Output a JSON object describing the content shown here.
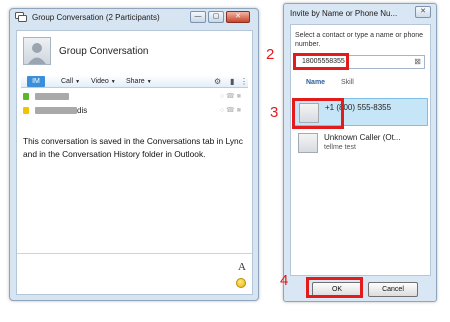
{
  "left_window": {
    "title": "Group Conversation (2 Participants)",
    "header_title": "Group Conversation",
    "toolbar": {
      "im_label": "IM",
      "call_label": "Call",
      "video_label": "Video",
      "share_label": "Share"
    },
    "participants": [
      {
        "name_suffix": "",
        "presence_color": "#5cb82a"
      },
      {
        "name_suffix": "dis",
        "presence_color": "#f2c400"
      }
    ],
    "message": "This conversation is saved in the Conversations tab in Lync and in the Conversation History folder in Outlook.",
    "compose": {
      "font_button": "A"
    }
  },
  "right_window": {
    "title": "Invite by Name or Phone Nu...",
    "instruction": "Select a contact or type a name or phone number.",
    "search_value": "18005558355",
    "columns": {
      "name": "Name",
      "skill": "Skill"
    },
    "results": [
      {
        "name": "+1 (800) 555-8355",
        "sub": "",
        "selected": true
      },
      {
        "name": "Unknown Caller (Ot...",
        "sub": "tellme test",
        "selected": false
      }
    ],
    "ok_label": "OK",
    "cancel_label": "Cancel"
  },
  "annotations": {
    "step2": "2",
    "step3": "3",
    "step4": "4",
    "color": "#e31b1b"
  }
}
